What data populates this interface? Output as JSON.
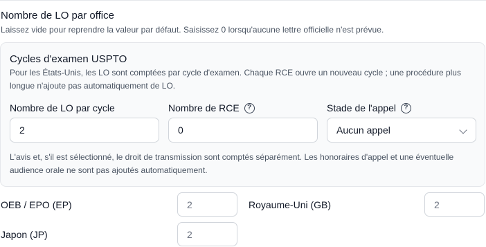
{
  "section": {
    "title": "Nombre de LO par office",
    "description": "Laissez vide pour reprendre la valeur par défaut. Saisissez 0 lorsqu'aucune lettre officielle n'est prévue."
  },
  "uspto": {
    "title": "Cycles d'examen USPTO",
    "description": "Pour les États-Unis, les LO sont comptées par cycle d'examen. Chaque RCE ouvre un nouveau cycle ; une procédure plus longue n'ajoute pas automatiquement de LO.",
    "fields": {
      "lo_per_cycle": {
        "label": "Nombre de LO par cycle",
        "value": "2"
      },
      "rce_count": {
        "label": "Nombre de RCE",
        "value": "0"
      },
      "appeal_stage": {
        "label": "Stade de l'appel",
        "selected": "Aucun appel"
      }
    },
    "note": "L'avis et, s'il est sélectionné, le droit de transmission sont comptés séparément. Les honoraires d'appel et une éventuelle audience orale ne sont pas ajoutés automatiquement."
  },
  "offices": [
    {
      "label": "OEB / EPO (EP)",
      "placeholder": "2"
    },
    {
      "label": "Royaume-Uni (GB)",
      "placeholder": "2"
    },
    {
      "label": "Japon (JP)",
      "placeholder": "2"
    }
  ],
  "icons": {
    "help": "question-circle-icon",
    "dropdown": "chevron-down-icon"
  }
}
